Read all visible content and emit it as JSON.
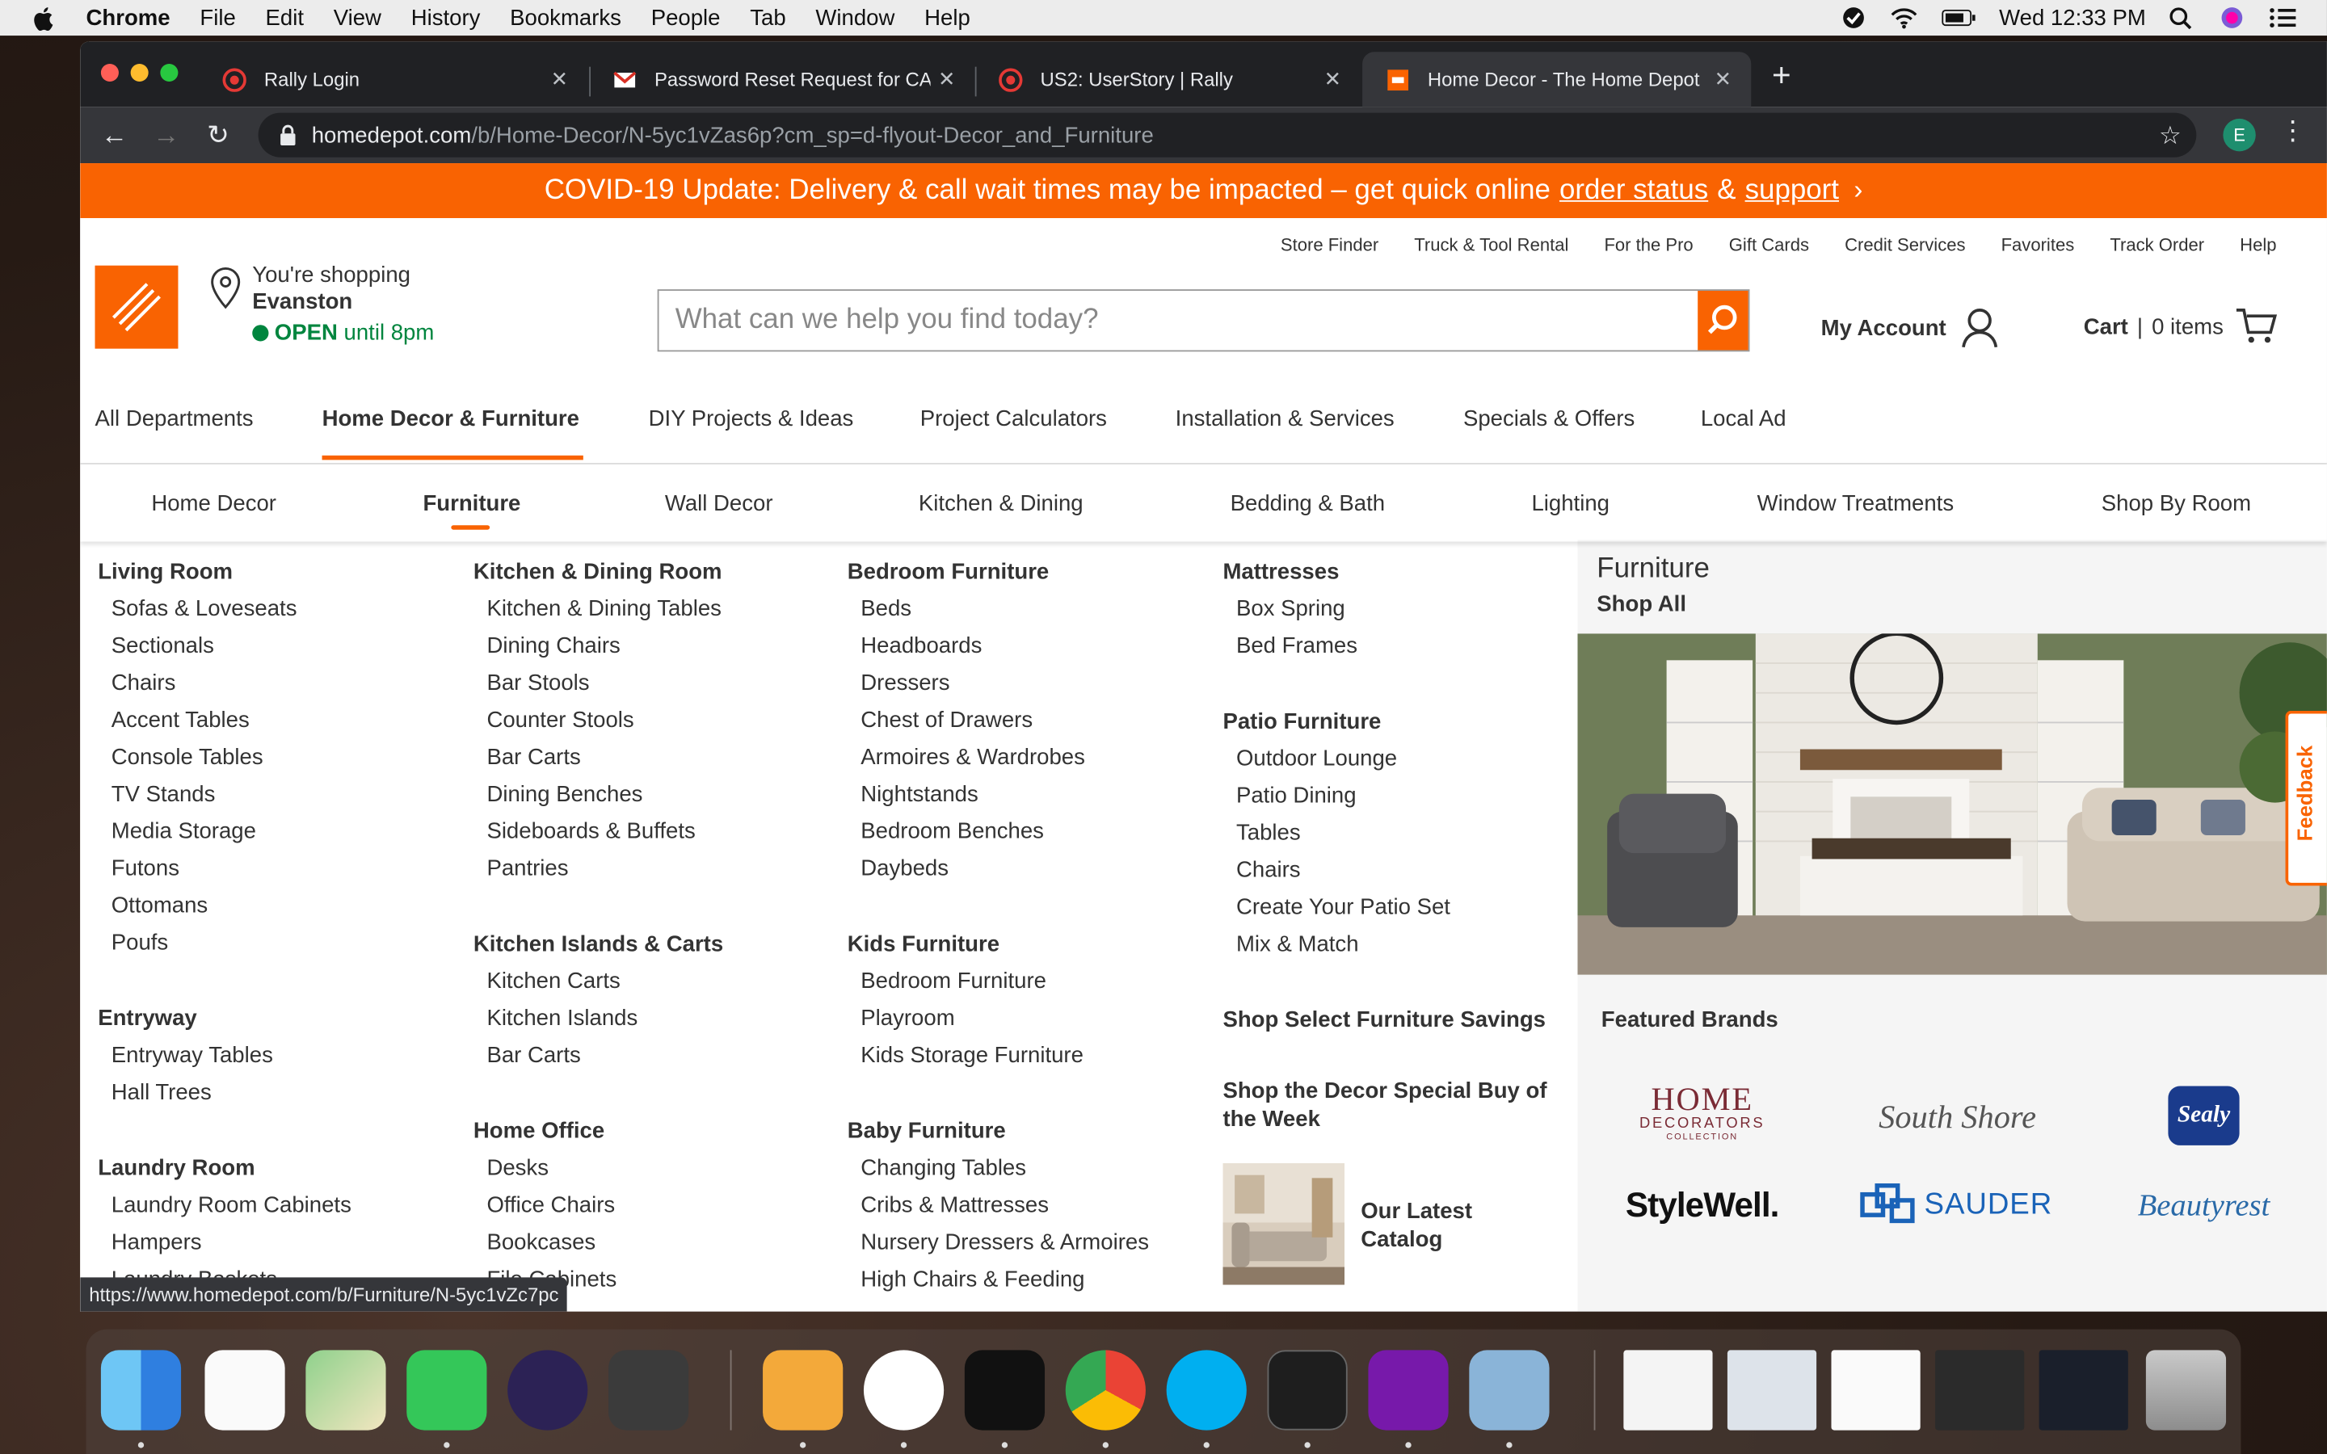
{
  "menubar": {
    "app": "Chrome",
    "items": [
      "File",
      "Edit",
      "View",
      "History",
      "Bookmarks",
      "People",
      "Tab",
      "Window",
      "Help"
    ],
    "clock": "Wed 12:33 PM"
  },
  "tabs": [
    {
      "title": "Rally Login",
      "favicon": "rally-icon"
    },
    {
      "title": "Password Reset Request for CA",
      "favicon": "gmail-icon"
    },
    {
      "title": "US2: UserStory | Rally",
      "favicon": "rally-icon"
    },
    {
      "title": "Home Decor - The Home Depot",
      "favicon": "homedepot-icon",
      "active": true
    }
  ],
  "address": {
    "host": "homedepot.com",
    "path": "/b/Home-Decor/N-5yc1vZas6p?cm_sp=d-flyout-Decor_and_Furniture"
  },
  "profile_initial": "E",
  "covid": {
    "text": "COVID-19 Update: Delivery & call wait times may be impacted – get quick online",
    "link1": "order status",
    "amp": "&",
    "link2": "support"
  },
  "utility_nav": [
    "Store Finder",
    "Truck & Tool Rental",
    "For the Pro",
    "Gift Cards",
    "Credit Services",
    "Favorites",
    "Track Order",
    "Help"
  ],
  "store": {
    "line1": "You're shopping",
    "name": "Evanston",
    "open": "OPEN",
    "hours": "until 8pm"
  },
  "search": {
    "placeholder": "What can we help you find today?"
  },
  "account": {
    "label": "My Account"
  },
  "cart": {
    "label": "Cart",
    "sep": "|",
    "count": "0 items"
  },
  "main_nav": [
    "All Departments",
    "Home Decor & Furniture",
    "DIY Projects & Ideas",
    "Project Calculators",
    "Installation & Services",
    "Specials & Offers",
    "Local Ad"
  ],
  "sub_nav": [
    "Home Decor",
    "Furniture",
    "Wall Decor",
    "Kitchen & Dining",
    "Bedding & Bath",
    "Lighting",
    "Window Treatments",
    "Shop By Room"
  ],
  "columns": [
    {
      "groups": [
        {
          "heading": "Living Room",
          "items": [
            "Sofas & Loveseats",
            "Sectionals",
            "Chairs",
            "Accent Tables",
            "Console Tables",
            "TV Stands",
            "Media Storage",
            "Futons",
            "Ottomans",
            "Poufs"
          ]
        },
        {
          "heading": "Entryway",
          "items": [
            "Entryway Tables",
            "Hall Trees"
          ]
        },
        {
          "heading": "Laundry Room",
          "items": [
            "Laundry Room Cabinets",
            "Hampers",
            "Laundry Baskets"
          ]
        }
      ]
    },
    {
      "groups": [
        {
          "heading": "Kitchen & Dining Room",
          "items": [
            "Kitchen & Dining Tables",
            "Dining Chairs",
            "Bar Stools",
            "Counter Stools",
            "Bar Carts",
            "Dining Benches",
            "Sideboards & Buffets",
            "Pantries"
          ]
        },
        {
          "heading": "Kitchen Islands & Carts",
          "items": [
            "Kitchen Carts",
            "Kitchen Islands",
            "Bar Carts"
          ]
        },
        {
          "heading": "Home Office",
          "items": [
            "Desks",
            "Office Chairs",
            "Bookcases",
            "File Cabinets"
          ]
        }
      ]
    },
    {
      "groups": [
        {
          "heading": "Bedroom Furniture",
          "items": [
            "Beds",
            "Headboards",
            "Dressers",
            "Chest of Drawers",
            "Armoires & Wardrobes",
            "Nightstands",
            "Bedroom Benches",
            "Daybeds"
          ]
        },
        {
          "heading": "Kids Furniture",
          "items": [
            "Bedroom Furniture",
            "Playroom",
            "Kids Storage Furniture"
          ]
        },
        {
          "heading": "Baby Furniture",
          "items": [
            "Changing Tables",
            "Cribs & Mattresses",
            "Nursery Dressers & Armoires",
            "High Chairs & Feeding"
          ]
        }
      ]
    },
    {
      "groups": [
        {
          "heading": "Mattresses",
          "items": [
            "Box Spring",
            "Bed Frames"
          ]
        },
        {
          "heading": "Patio Furniture",
          "items": [
            "Outdoor Lounge",
            "Patio Dining",
            "Tables",
            "Chairs",
            "Create Your Patio Set",
            "Mix & Match"
          ]
        }
      ],
      "links": [
        "Shop Select Furniture Savings",
        "Shop the Decor Special Buy of the Week"
      ],
      "catalog": "Our Latest Catalog"
    }
  ],
  "promo": {
    "title": "Furniture",
    "shop_all": "Shop All",
    "featured": "Featured Brands",
    "brands": [
      {
        "line1": "HOME",
        "line2": "DECORATORS",
        "line3": "COLLECTION"
      },
      {
        "name": "South Shore"
      },
      {
        "name": "Sealy"
      },
      {
        "name": "StyleWell."
      },
      {
        "name": "SAUDER"
      },
      {
        "name": "Beautyrest"
      }
    ]
  },
  "feedback": "Feedback",
  "status_url": "https://www.homedepot.com/b/Furniture/N-5yc1vZc7pc",
  "colors": {
    "brand_orange": "#f96302",
    "open_green": "#00853e"
  },
  "dock": [
    "finder-icon",
    "reminders-icon",
    "maps-icon",
    "facetime-icon",
    "eclipse-icon",
    "sublime-icon",
    "pages-icon",
    "slack-icon",
    "intellij-icon",
    "chrome-icon",
    "skype-icon",
    "terminal-icon",
    "onenote-icon",
    "preview-icon",
    "trash-icon"
  ]
}
